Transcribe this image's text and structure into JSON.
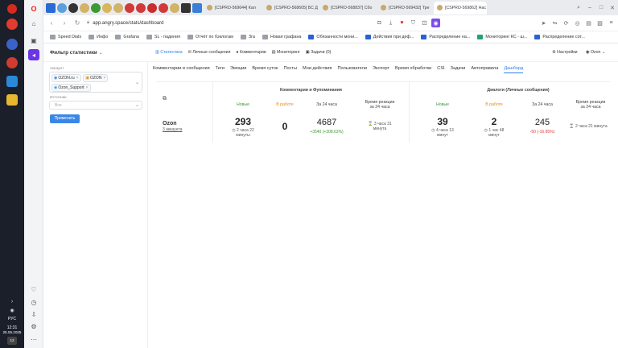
{
  "taskbar": {
    "time": "12:31",
    "date": "25.05.2025",
    "lang": "РУС",
    "notif_count": "12"
  },
  "tabs": {
    "items": [
      {
        "label": "[CSPRO-569644] Кал"
      },
      {
        "label": "[CSPRO-568605] БС Д"
      },
      {
        "label": "[CSPRO-568837] Сбо"
      },
      {
        "label": "[CSPRO-569432] Тре"
      },
      {
        "label": "[CSPRO-569862] Нас"
      }
    ]
  },
  "address": {
    "url": "app.angry.space/stats/dashboard"
  },
  "bookmarks": [
    {
      "label": "Speed Dials"
    },
    {
      "label": "Инфо"
    },
    {
      "label": "Grafana"
    },
    {
      "label": "SL - падения"
    },
    {
      "label": "Отчёт по бэклогам"
    },
    {
      "label": "Зга"
    },
    {
      "label": "Новая графана"
    },
    {
      "label": "Обязанности мони..."
    },
    {
      "label": "Действия при деф..."
    },
    {
      "label": "Распределение на..."
    },
    {
      "label": "Мониторинг КС - ш..."
    },
    {
      "label": "Распределение сот..."
    }
  ],
  "app": {
    "filter_title": "Фильтр статистики",
    "nav": [
      {
        "label": "Статистика"
      },
      {
        "label": "Личные сообщения"
      },
      {
        "label": "Комментарии"
      },
      {
        "label": "Мониторинг"
      },
      {
        "label": "Задачи (0)"
      }
    ],
    "settings": "Настройки",
    "user": "Ozon"
  },
  "filter": {
    "account_label": "Аккаунт",
    "chips": [
      "OZON.ru",
      "OZON",
      "Ozon_Support"
    ],
    "source_label": "Источник",
    "source_value": "Все",
    "apply": "Применить"
  },
  "subtabs": [
    {
      "label": "Комментарии и сообщения"
    },
    {
      "label": "Теги"
    },
    {
      "label": "Эмоции"
    },
    {
      "label": "Время суток"
    },
    {
      "label": "Посты"
    },
    {
      "label": "Мои действия"
    },
    {
      "label": "Пользователи"
    },
    {
      "label": "Экспорт"
    },
    {
      "label": "Время обработки"
    },
    {
      "label": "CSI"
    },
    {
      "label": "Задачи"
    },
    {
      "label": "Автоправила"
    },
    {
      "label": "Дашборд"
    }
  ],
  "dashboard": {
    "group1": {
      "title": "Комментарии и Фупоминания"
    },
    "group2": {
      "title": "Диалоги (Личные сообщения)"
    },
    "headers": {
      "new": "Новые",
      "in_work": "В работе",
      "per24": "За 24 часа",
      "reaction": "Время реакции",
      "reaction2": "за 24 часа"
    },
    "row": {
      "account": "Ozon",
      "account_sub": "3 аккаунта",
      "g1_new": "293",
      "g1_new_time": "2 часа 22",
      "g1_new_time2": "минуты",
      "g1_work": "0",
      "g1_24": "4687",
      "g1_24_delta": "+3540 (+308.63%)",
      "g1_react": "3 часа 31",
      "g1_react2": "минута",
      "g2_new": "39",
      "g2_new_time": "4 часа 13",
      "g2_new_time2": "минут",
      "g2_work": "2",
      "g2_work_time": "1 час 48",
      "g2_work_time2": "минут",
      "g2_24": "245",
      "g2_24_delta": "-50 (-16.95%)",
      "g2_react": "2 часа 21 минута"
    }
  }
}
